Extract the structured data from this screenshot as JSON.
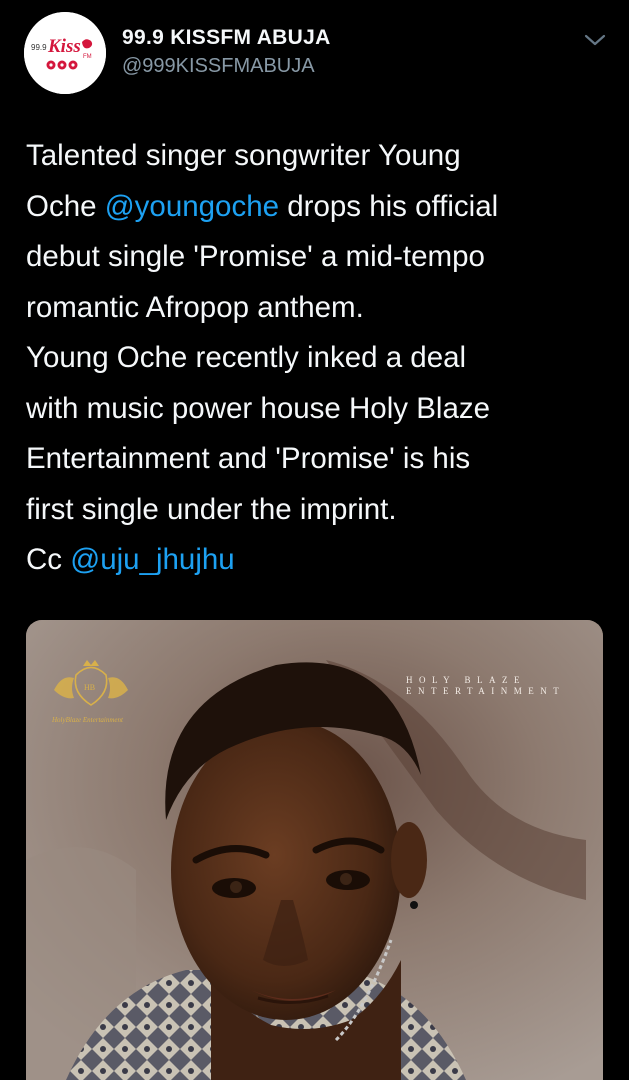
{
  "account": {
    "display_name": "99.9 KISSFM ABUJA",
    "handle": "@999KISSFMABUJA",
    "avatar_text": "99.9 Kiss FM"
  },
  "tweet": {
    "lines": [
      [
        {
          "text": "Talented singer songwriter Young"
        }
      ],
      [
        {
          "text": "Oche "
        },
        {
          "text": "@youngoche",
          "mention": true
        },
        {
          "text": " drops his official"
        }
      ],
      [
        {
          "text": "debut single 'Promise' a mid-tempo"
        }
      ],
      [
        {
          "text": "romantic Afropop anthem."
        }
      ],
      [
        {
          "text": "Young Oche recently inked a deal"
        }
      ],
      [
        {
          "text": "with music power house Holy Blaze"
        }
      ],
      [
        {
          "text": "Entertainment and 'Promise' is his"
        }
      ],
      [
        {
          "text": "first single under the imprint."
        }
      ],
      [
        {
          "text": "Cc "
        },
        {
          "text": "@uju_jhujhu",
          "mention": true
        }
      ]
    ]
  },
  "media": {
    "brand_line1": "HOLY BLAZE",
    "brand_line2": "ENTERTAINMENT",
    "logo_signature": "HolyBlaze Entertainment"
  },
  "colors": {
    "background": "#000000",
    "text": "#f5f8fa",
    "secondary": "#8899a6",
    "link": "#1da1f2"
  },
  "icons": {
    "menu": "chevron-down-icon"
  }
}
